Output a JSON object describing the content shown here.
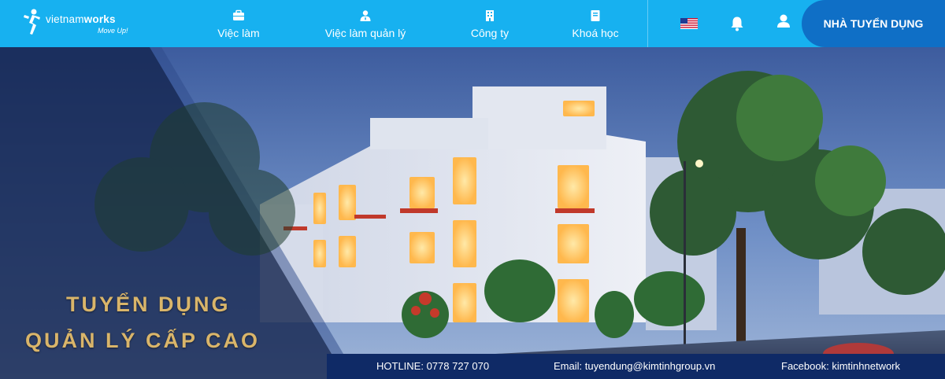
{
  "brand": {
    "name_light": "vietnam",
    "name_bold": "works",
    "tagline": "Move Up!"
  },
  "nav": {
    "items": [
      {
        "label": "Việc làm",
        "icon": "briefcase-icon"
      },
      {
        "label": "Việc làm quản lý",
        "icon": "manager-icon"
      },
      {
        "label": "Công ty",
        "icon": "building-icon"
      },
      {
        "label": "Khoá học",
        "icon": "book-icon"
      }
    ],
    "language_icon": "us-flag-icon",
    "notification_icon": "bell-icon",
    "account_icon": "user-icon",
    "employer_label": "NHÀ TUYỂN DỤNG"
  },
  "banner": {
    "headline_line1": "TUYỂN DỤNG",
    "headline_line2": "QUẢN LÝ CẤP CAO",
    "hotline": "HOTLINE: 0778 727 070",
    "email": "Email: tuyendung@kimtinhgroup.vn",
    "facebook": "Facebook: kimtinhnetwork"
  },
  "colors": {
    "nav_bg": "#17b1f0",
    "employer_bg": "#0f6fc6",
    "headline_gold": "#d9b56a",
    "contact_bar_bg": "#0f2a66"
  }
}
